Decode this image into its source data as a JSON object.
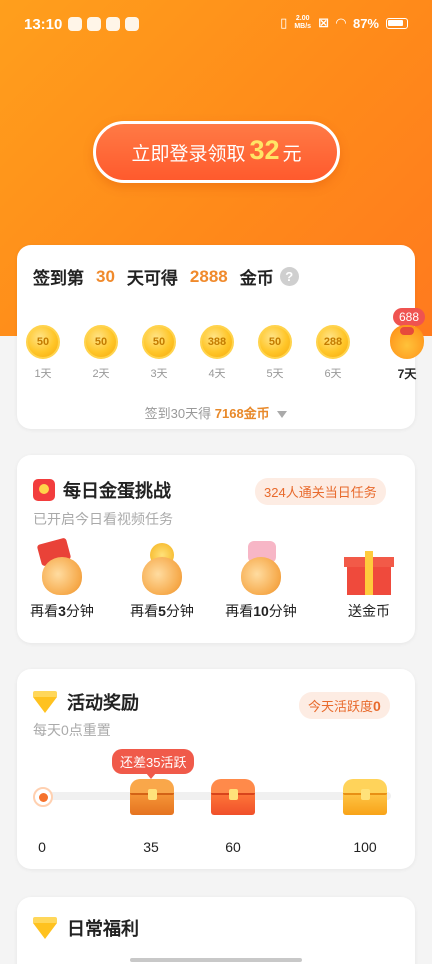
{
  "status": {
    "time": "13:10",
    "speed_value": "2.00",
    "speed_unit": "MB/s",
    "battery": "87%"
  },
  "login": {
    "prefix": "立即登录领取",
    "amount": "32",
    "suffix": "元"
  },
  "signin": {
    "label_a": "签到第",
    "day_count": "30",
    "label_b": "天可得",
    "coins": "2888",
    "label_c": "金币",
    "help": "?",
    "days": [
      {
        "value": "50",
        "label": "1天"
      },
      {
        "value": "50",
        "label": "2天"
      },
      {
        "value": "50",
        "label": "3天"
      },
      {
        "value": "388",
        "label": "4天"
      },
      {
        "value": "50",
        "label": "5天"
      },
      {
        "value": "288",
        "label": "6天"
      },
      {
        "value": "688",
        "label": "7天"
      }
    ],
    "footer_prefix": "签到30天得",
    "footer_amount": "7168金币"
  },
  "egg": {
    "title": "每日金蛋挑战",
    "subtitle": "已开启今日看视频任务",
    "pill": "324人通关当日任务",
    "items": [
      {
        "pre": "再看",
        "num": "3",
        "post": "分钟"
      },
      {
        "pre": "再看",
        "num": "5",
        "post": "分钟"
      },
      {
        "pre": "再看",
        "num": "10",
        "post": "分钟"
      },
      {
        "pre": "送金币",
        "num": "",
        "post": ""
      }
    ]
  },
  "activity": {
    "title": "活动奖励",
    "subtitle": "每天0点重置",
    "pill_label": "今天活跃度",
    "pill_value": "0",
    "tooltip": "还差35活跃",
    "progress": 0,
    "marks": [
      "0",
      "35",
      "60",
      "100"
    ]
  },
  "welfare": {
    "title": "日常福利"
  }
}
